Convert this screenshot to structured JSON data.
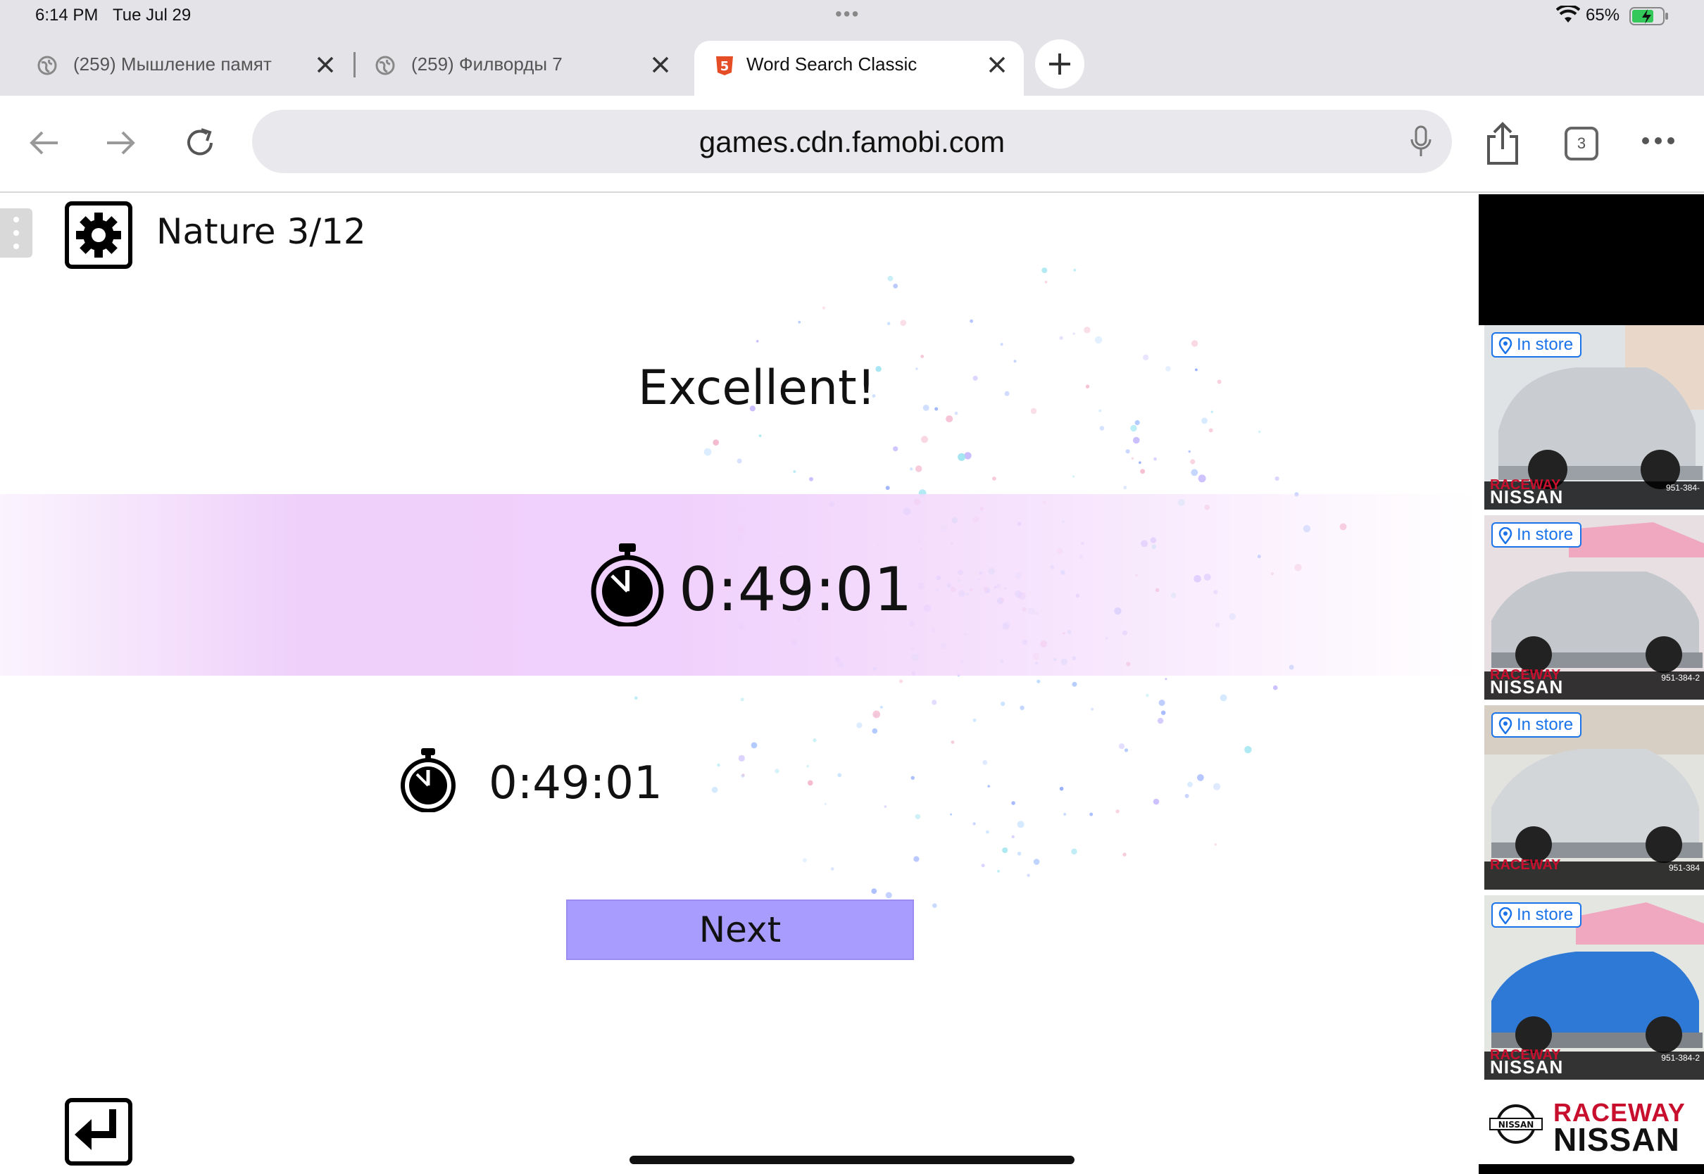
{
  "status_bar": {
    "time": "6:14 PM",
    "date": "Tue Jul 29",
    "battery_percent": "65%"
  },
  "tabs": [
    {
      "label": "(259) Мышление памят",
      "active": false,
      "icon": "globe-icon"
    },
    {
      "label": "(259) Филворды 7",
      "active": false,
      "icon": "globe-icon"
    },
    {
      "label": "Word Search Classic",
      "active": true,
      "icon": "html5-icon"
    }
  ],
  "toolbar": {
    "url": "games.cdn.famobi.com",
    "tab_count": "3"
  },
  "game": {
    "level_label": "Nature 3/12",
    "headline": "Excellent!",
    "time": "0:49:01",
    "best_time": "0:49:01",
    "next_label": "Next"
  },
  "ad": {
    "badge_label": "In store",
    "cards": [
      {
        "brand_top": "RACEWAY",
        "brand": "NISSAN",
        "phone": "951-384-",
        "car_color": "#c9cdd1"
      },
      {
        "brand_top": "RACEWAY",
        "brand": "NISSAN",
        "phone": "951-384-2",
        "car_color": "#c4c8cc"
      },
      {
        "brand_top": "RACEWAY",
        "brand": "",
        "phone": "951-384",
        "car_color": "#d3d6d9"
      },
      {
        "brand_top": "RACEWAY",
        "brand": "NISSAN",
        "phone": "951-384-2",
        "car_color": "#2f79d6"
      }
    ],
    "logo_ring_text": "NISSAN",
    "logo_raceway": "RACEWAY",
    "logo_nissan": "NISSAN"
  },
  "colors": {
    "next_button": "#a89cff",
    "time_band": "#f0d0fc",
    "ad_badge": "#1a73e8",
    "brand_red": "#c8102e"
  }
}
